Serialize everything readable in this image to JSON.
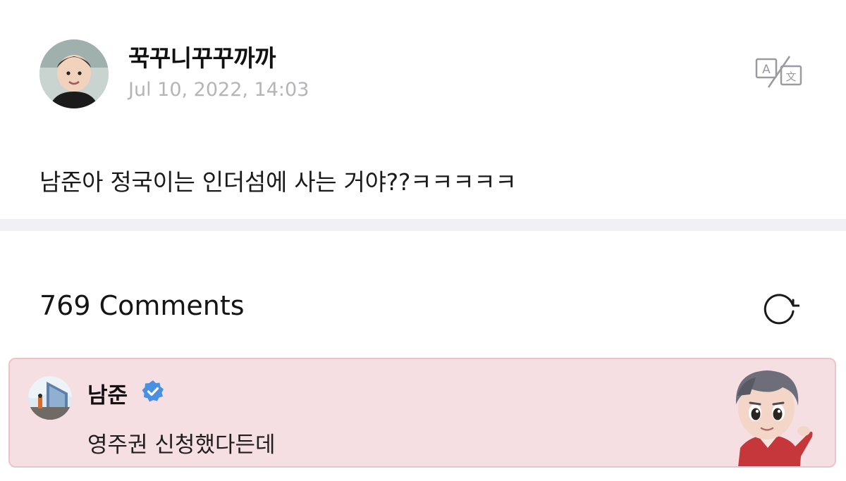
{
  "post": {
    "author": "꾹꾸니꾸꾸까까",
    "timestamp": "Jul 10, 2022, 14:03",
    "body": "남준아 정국이는 인더섬에 사는 거야??ㅋㅋㅋㅋㅋ",
    "translate_icon": "translate-icon"
  },
  "comments": {
    "count_label": "769 Comments",
    "refresh_icon": "refresh-icon",
    "highlighted": {
      "author": "남준",
      "verified": true,
      "text": "영주권 신청했다든데",
      "background_color": "#f6dfe3",
      "badge_color": "#4a90e2"
    }
  }
}
